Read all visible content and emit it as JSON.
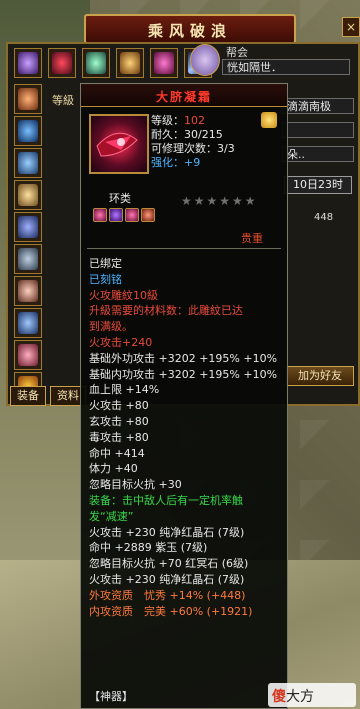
{
  "window": {
    "title": "乘风破浪",
    "help_label": "?",
    "close_label": "×"
  },
  "character": {
    "left_label": "等級",
    "guild_label": "帮会",
    "guild_name": "恍如隔世．",
    "partner": "滴滴南极",
    "field_row3": "",
    "field_row4": "朵..",
    "time_box": "10日23时",
    "side_number": "448",
    "add_friend_label": "加为好友",
    "tabs": [
      "装备",
      "资料"
    ]
  },
  "tooltip": {
    "item_name": "大脐凝霜",
    "stats": {
      "grade_label": "等级：",
      "grade_value": "102",
      "durability": "耐久：30/215",
      "repair": "可修理次数：3/3",
      "enhance_label": "强化：",
      "enhance_value": "+9"
    },
    "class_label": "环类",
    "stars": "★★★★★★",
    "valuable_label": "贵重",
    "lines": [
      {
        "text": "已绑定",
        "color": "white"
      },
      {
        "text": "已刻铭",
        "color": "cyan"
      },
      {
        "text": "火攻雕紋10級",
        "color": "red"
      },
      {
        "text": "升級需要的材料数：此雕紋已达",
        "color": "red"
      },
      {
        "text": "到满级。",
        "color": "red"
      },
      {
        "text": "火攻击+240",
        "color": "red"
      },
      {
        "text": "基础外功攻击 +3202 +195% +10%",
        "color": "white"
      },
      {
        "text": "基础内功攻击 +3202 +195% +10%",
        "color": "white"
      },
      {
        "text": "血上限 +14%",
        "color": "white"
      },
      {
        "text": "火攻击 +80",
        "color": "white"
      },
      {
        "text": "玄攻击 +80",
        "color": "white"
      },
      {
        "text": "毒攻击 +80",
        "color": "white"
      },
      {
        "text": "命中 +414",
        "color": "white"
      },
      {
        "text": "体力 +40",
        "color": "white"
      },
      {
        "text": "忽略目标火抗 +30",
        "color": "white"
      },
      {
        "text": "装备：击中敌人后有一定机率触",
        "color": "green"
      },
      {
        "text": "发“减速”",
        "color": "green"
      },
      {
        "text": "火攻击 +230 纯净红晶石 (7级)",
        "color": "white"
      },
      {
        "text": "命中 +2889 紫玉 (7级)",
        "color": "white"
      },
      {
        "text": "忽略目标火抗 +70 红冥石 (6级)",
        "color": "white"
      },
      {
        "text": "火攻击 +230 纯净红晶石 (7级)",
        "color": "white"
      },
      {
        "text": "外攻资质　忧秀 +14% (+448)",
        "color": "orange"
      },
      {
        "text": "内攻资质　完美 +60% (+1921)",
        "color": "orange"
      }
    ],
    "footer": "【神器】"
  },
  "watermark": {
    "mark": "傻",
    "text": "大方"
  },
  "icons": [
    "help-icon",
    "close-icon",
    "guild-emblem-icon",
    "gear-icon",
    "gem-icon"
  ],
  "colors": {
    "item_name": "#ff3a2b",
    "highlight_red": "#e84a3c",
    "highlight_green": "#38d84a",
    "highlight_cyan": "#4fb3ff",
    "quality_orange": "#ff7a3a"
  }
}
